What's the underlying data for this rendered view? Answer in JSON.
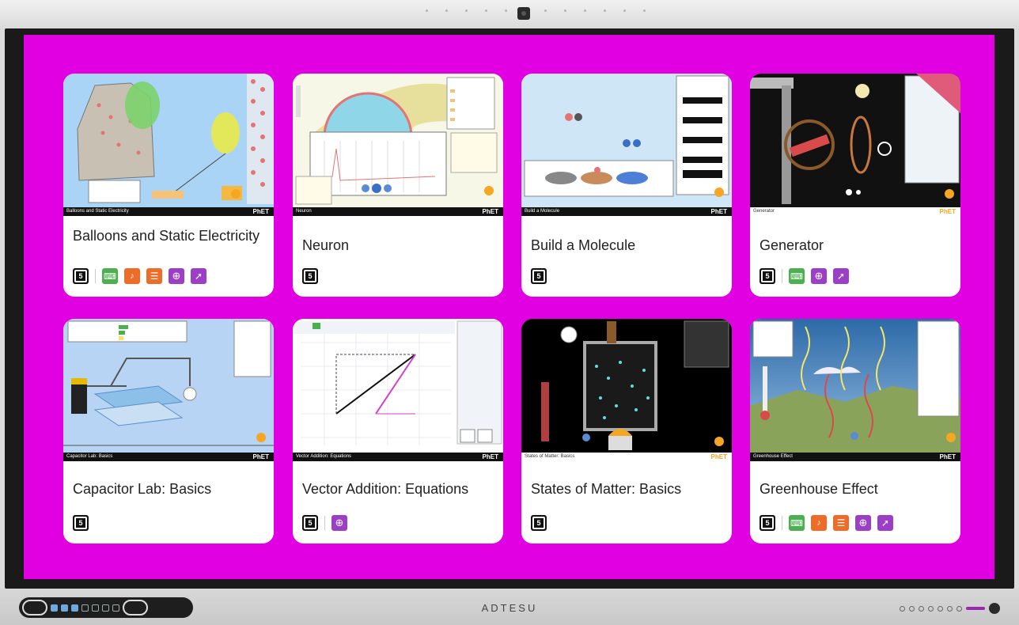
{
  "device": {
    "brand": "ADTESU"
  },
  "cards": [
    {
      "title": "Balloons and Static Electricity",
      "thumb_bar": "Balloons and Static Electricity",
      "features": [
        "html5",
        "keyboard",
        "sound",
        "description",
        "zoom",
        "mobile"
      ]
    },
    {
      "title": "Neuron",
      "thumb_bar": "Neuron",
      "features": [
        "html5"
      ]
    },
    {
      "title": "Build a Molecule",
      "thumb_bar": "Build a Molecule",
      "features": [
        "html5"
      ]
    },
    {
      "title": "Generator",
      "thumb_bar": "Generator",
      "features": [
        "html5",
        "keyboard",
        "zoom",
        "mobile"
      ]
    },
    {
      "title": "Capacitor Lab: Basics",
      "thumb_bar": "Capacitor Lab: Basics",
      "features": [
        "html5"
      ]
    },
    {
      "title": "Vector Addition: Equations",
      "thumb_bar": "Vector Addition: Equations",
      "features": [
        "html5",
        "zoom"
      ]
    },
    {
      "title": "States of Matter: Basics",
      "thumb_bar": "States of Matter: Basics",
      "features": [
        "html5"
      ]
    },
    {
      "title": "Greenhouse Effect",
      "thumb_bar": "Greenhouse Effect",
      "features": [
        "html5",
        "keyboard",
        "sound",
        "description",
        "zoom",
        "mobile"
      ]
    }
  ],
  "phet_label": "PhET",
  "colors": {
    "screen_bg": "#e100e1",
    "card_bg": "#ffffff"
  }
}
